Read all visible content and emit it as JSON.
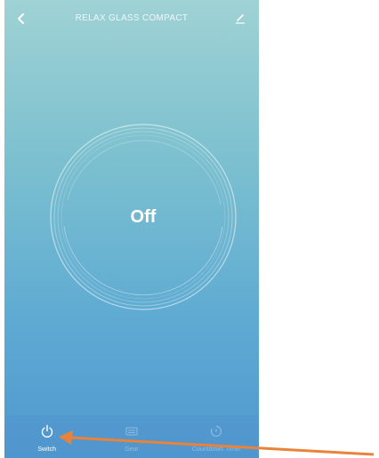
{
  "header": {
    "title": "RELAX GLASS COMPACT",
    "back_icon": "chevron-left-icon",
    "edit_icon": "pencil-icon"
  },
  "main": {
    "state_label": "Off"
  },
  "tabs": [
    {
      "label": "Switch",
      "icon": "power-icon",
      "active": true
    },
    {
      "label": "Gear",
      "icon": "heater-icon",
      "active": false
    },
    {
      "label": "Countdown Timer",
      "icon": "timer-icon",
      "active": false
    }
  ],
  "colors": {
    "gradient_top": "#9fd2d4",
    "gradient_bottom": "#4f98cf",
    "annotation_arrow": "#e9823a"
  }
}
